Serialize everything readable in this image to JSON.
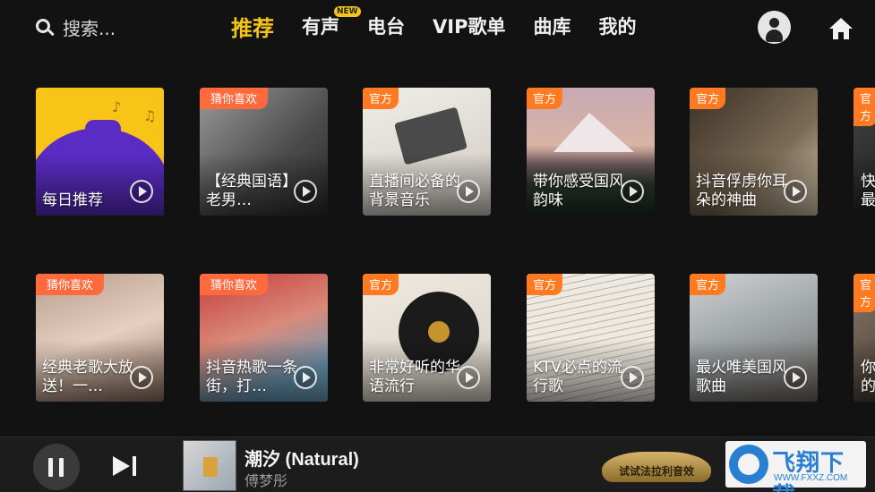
{
  "header": {
    "search": {
      "placeholder": "搜索..."
    },
    "tabs": [
      {
        "label": "推荐"
      },
      {
        "label": "有声",
        "badge": "NEW"
      },
      {
        "label": "电台"
      },
      {
        "label": "VIP歌单"
      },
      {
        "label": "曲库"
      },
      {
        "label": "我的"
      }
    ]
  },
  "cards": [
    {
      "tag": "",
      "title": "每日推荐"
    },
    {
      "tag": "猜你喜欢",
      "title": "【经典国语】老男…"
    },
    {
      "tag": "官方",
      "title": "直播间必备的背景音乐"
    },
    {
      "tag": "官方",
      "title": "带你感受国风韵味"
    },
    {
      "tag": "官方",
      "title": "抖音俘虏你耳朵的神曲"
    },
    {
      "tag": "官方",
      "title": "快最"
    },
    {
      "tag": "猜你喜欢",
      "title": "经典老歌大放送！一…"
    },
    {
      "tag": "猜你喜欢",
      "title": "抖音热歌一条街，打…"
    },
    {
      "tag": "官方",
      "title": "非常好听的华语流行"
    },
    {
      "tag": "官方",
      "title": "KTV必点的流行歌"
    },
    {
      "tag": "官方",
      "title": "最火唯美国风歌曲"
    },
    {
      "tag": "官方",
      "title": "你的"
    }
  ],
  "player": {
    "song_title": "潮汐 (Natural)",
    "artist": "傅梦彤",
    "ferrari_label": "试试法拉利音效"
  },
  "watermark": {
    "title": "飞翔下载",
    "url": "WWW.FXXZ.COM"
  }
}
